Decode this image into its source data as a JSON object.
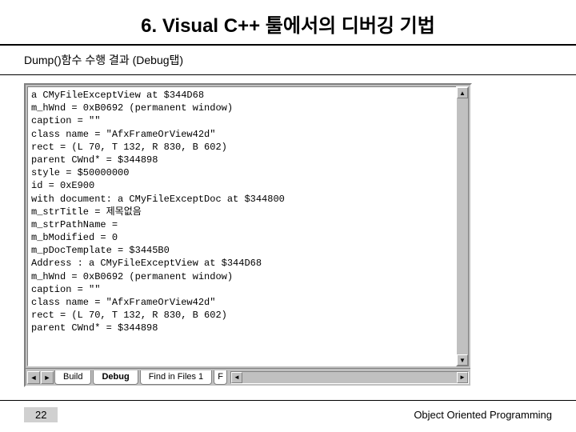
{
  "slide": {
    "title": "6. Visual C++ 툴에서의 디버깅 기법",
    "subtitle": "Dump()함수 수행 결과 (Debug탭)"
  },
  "output": {
    "lines": [
      "a CMyFileExceptView at $344D68",
      "",
      "m_hWnd = 0xB0692 (permanent window)",
      "caption = \"\"",
      "class name = \"AfxFrameOrView42d\"",
      "rect = (L 70, T 132, R 830, B 602)",
      "parent CWnd* = $344898",
      "style = $50000000",
      "id = 0xE900",
      "with document: a CMyFileExceptDoc at $344800",
      "m_strTitle = 제목없음",
      "m_strPathName = ",
      "m_bModified = 0",
      "m_pDocTemplate = $3445B0",
      "Address : a CMyFileExceptView at $344D68",
      "",
      "m_hWnd = 0xB0692 (permanent window)",
      "caption = \"\"",
      "class name = \"AfxFrameOrView42d\"",
      "rect = (L 70, T 132, R 830, B 602)",
      "parent CWnd* = $344898"
    ]
  },
  "tabs": {
    "build": "Build",
    "debug": "Debug",
    "find": "Find in Files 1",
    "extra": "F"
  },
  "footer": {
    "page": "22",
    "course": "Object Oriented Programming"
  },
  "glyphs": {
    "up": "▲",
    "down": "▼",
    "left": "◄",
    "right": "►"
  }
}
